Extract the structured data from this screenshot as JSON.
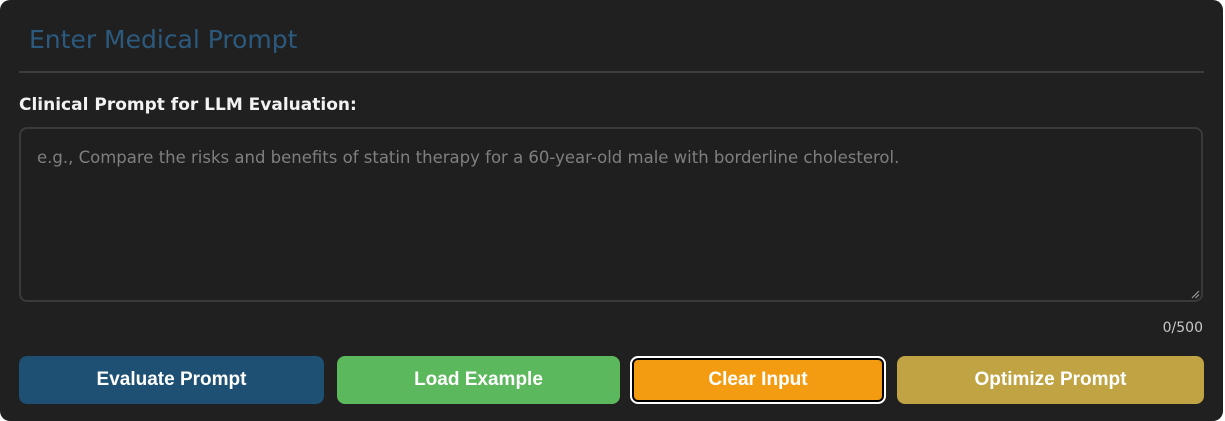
{
  "section": {
    "title": "Enter Medical Prompt"
  },
  "prompt_field": {
    "label": "Clinical Prompt for LLM Evaluation:",
    "value": "",
    "placeholder": "e.g., Compare the risks and benefits of statin therapy for a 60-year-old male with borderline cholesterol.",
    "char_count": "0/500"
  },
  "actions": {
    "evaluate_label": "Evaluate Prompt",
    "load_example_label": "Load Example",
    "clear_label": "Clear Input",
    "optimize_label": "Optimize Prompt"
  },
  "colors": {
    "panel_background": "#202020",
    "title": "#2c5a7e",
    "evaluate": "#1e5074",
    "load_example": "#5cb85c",
    "clear": "#f39c12",
    "optimize": "#c0a342"
  },
  "icons": {
    "resize_grip": "resize-grip-icon"
  }
}
